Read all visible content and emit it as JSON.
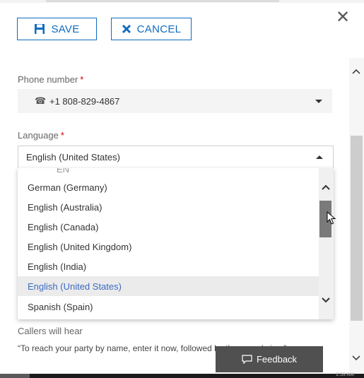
{
  "toolbar": {
    "save_label": "SAVE",
    "cancel_label": "CANCEL",
    "save_icon": "floppy-disk-icon",
    "cancel_icon": "x-icon",
    "close_icon": "close-icon",
    "close_glyph": "✕"
  },
  "form": {
    "phone": {
      "label": "Phone number",
      "required_mark": "*",
      "value": "+1 808-829-4867",
      "icon": "phone-icon",
      "icon_glyph": "☎"
    },
    "language": {
      "label": "Language",
      "required_mark": "*",
      "value": "English (United States)",
      "expanded": true
    },
    "language_options": {
      "clipped_top": "EN",
      "items": [
        "German (Germany)",
        "English (Australia)",
        "English (Canada)",
        "English (United Kingdom)",
        "English (India)",
        "English (United States)",
        "Spanish (Spain)"
      ],
      "selected": "English (United States)"
    },
    "callers_will_hear": {
      "label": "Callers will hear",
      "text": "“To reach your party by name, enter it now, followed by the pound sign.”"
    }
  },
  "feedback": {
    "label": "Feedback",
    "icon": "chat-bubble-icon"
  },
  "taskbar": {
    "clock": "2:59 AM"
  },
  "colors": {
    "accent": "#0f6cbd",
    "required": "#cc0000",
    "selected_text": "#3b6bbf",
    "selected_bg": "#ebebeb",
    "feedback_bg": "#505050"
  }
}
